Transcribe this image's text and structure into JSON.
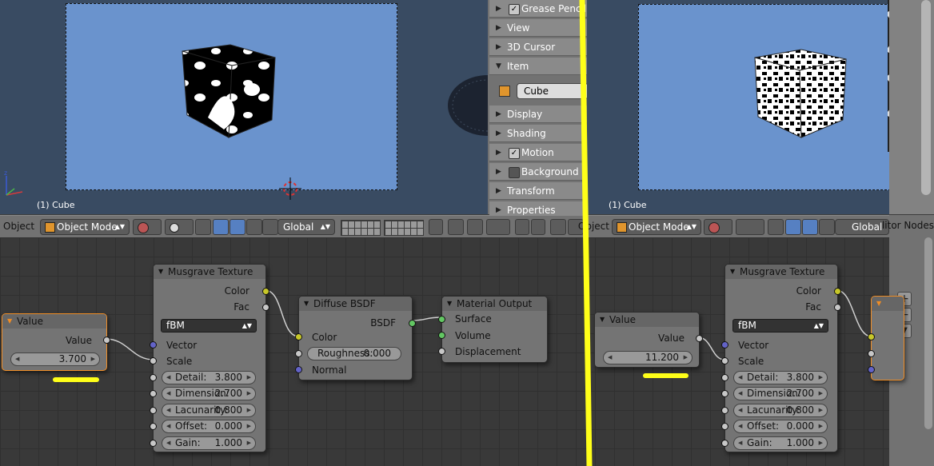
{
  "viewport_left": {
    "label": "(1) Cube"
  },
  "viewport_right": {
    "label": "(1) Cube"
  },
  "properties_panel": {
    "items": [
      {
        "label": "Grease Pencil",
        "checkbox": true,
        "expanded": false
      },
      {
        "label": "View",
        "expanded": false
      },
      {
        "label": "3D Cursor",
        "expanded": false
      },
      {
        "label": "Item",
        "expanded": true
      },
      {
        "label": "Display",
        "expanded": false
      },
      {
        "label": "Shading",
        "expanded": false
      },
      {
        "label": "Motion Tracking",
        "checkbox": true,
        "expanded": false
      },
      {
        "label": "Background Images",
        "checkbox": false,
        "expanded": false
      },
      {
        "label": "Transform Orientations",
        "expanded": false
      },
      {
        "label": "Properties",
        "expanded": false
      }
    ],
    "item_name": "Cube"
  },
  "header_left": {
    "object_menu": "Object",
    "mode": "Object Mode",
    "orientation": "Global"
  },
  "header_right": {
    "object_menu": "Object",
    "mode": "Object Mode",
    "orientation": "Global",
    "editor_name": "Node Editor Nodes"
  },
  "nodes_left": {
    "value": {
      "title": "Value",
      "output": "Value",
      "field": "3.700"
    },
    "musgrave": {
      "title": "Musgrave Texture",
      "out_color": "Color",
      "out_fac": "Fac",
      "type": "fBM",
      "in_vector": "Vector",
      "in_scale": "Scale",
      "detail_label": "Detail:",
      "detail": "3.800",
      "dimension_label": "Dimension:",
      "dimension": "2.700",
      "lacunarity_label": "Lacunarity:",
      "lacunarity": "0.800",
      "offset_label": "Offset:",
      "offset": "0.000",
      "gain_label": "Gain:",
      "gain": "1.000"
    },
    "diffuse": {
      "title": "Diffuse BSDF",
      "out": "BSDF",
      "in_color": "Color",
      "roughness_label": "Roughness:",
      "roughness": "0.000",
      "in_normal": "Normal"
    },
    "output": {
      "title": "Material Output",
      "surface": "Surface",
      "volume": "Volume",
      "displacement": "Displacement"
    }
  },
  "nodes_right": {
    "value": {
      "title": "Value",
      "output": "Value",
      "field": "11.200"
    },
    "musgrave": {
      "title": "Musgrave Texture",
      "out_color": "Color",
      "out_fac": "Fac",
      "type": "fBM",
      "in_vector": "Vector",
      "in_scale": "Scale",
      "detail_label": "Detail:",
      "detail": "3.800",
      "dimension_label": "Dimension:",
      "dimension": "2.700",
      "lacunarity_label": "Lacunarity:",
      "lacunarity": "0.800",
      "offset_label": "Offset:",
      "offset": "0.000",
      "gain_label": "Gain:",
      "gain": "1.000"
    }
  },
  "colors": {
    "highlight": "#ffff19",
    "viewport_bg": "#394b62",
    "camera_bg": "#6a93cd",
    "socket_yellow": "#c7c729",
    "socket_green": "#63c763",
    "socket_blue": "#6363c7"
  }
}
